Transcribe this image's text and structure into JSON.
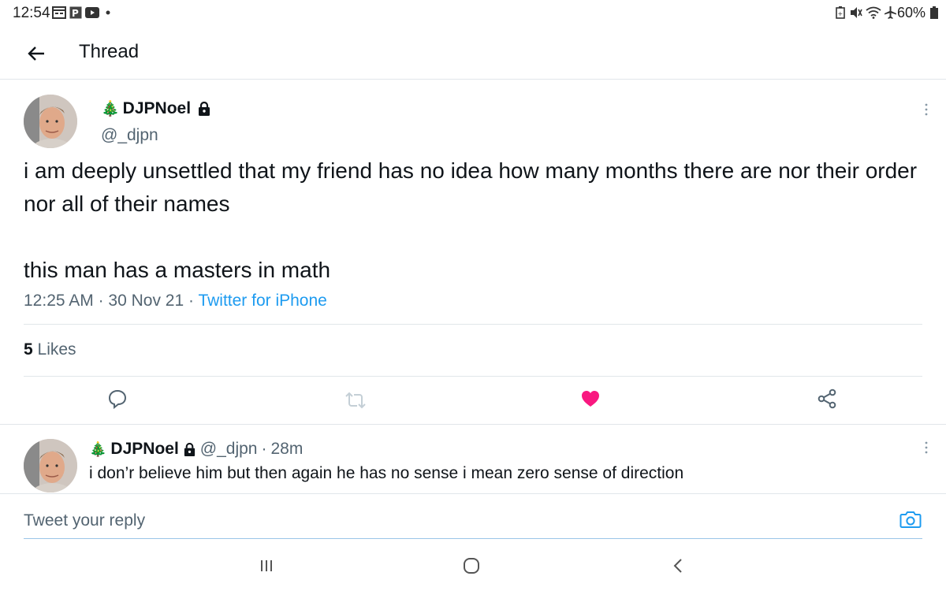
{
  "status_bar": {
    "time": "12:54",
    "battery": "60%"
  },
  "header": {
    "title": "Thread"
  },
  "tweet": {
    "author_emoji": "🎄",
    "author_name": "DJPNoel",
    "author_handle": "@_djpn",
    "text": "i am deeply unsettled that my friend has no idea how many months there are nor their order nor all of their names\n\nthis man has a masters in math",
    "time": "12:25 AM",
    "date": "30 Nov 21",
    "source": "Twitter for iPhone",
    "likes_count": "5",
    "likes_label": " Likes",
    "colors": {
      "like_active": "#f91880",
      "link": "#1d9bf0"
    }
  },
  "reply": {
    "author_emoji": "🎄",
    "author_name": "DJPNoel",
    "author_handle": "@_djpn",
    "age": "28m",
    "text": "i don’r believe him but then again he has no sense i mean zero sense of direction"
  },
  "compose": {
    "placeholder": "Tweet your reply"
  },
  "icons": [
    "back-arrow-icon",
    "lock-icon",
    "more-icon",
    "reply-icon",
    "retweet-icon",
    "heart-icon",
    "share-icon",
    "camera-icon",
    "recents-icon",
    "home-icon",
    "nav-back-icon"
  ]
}
